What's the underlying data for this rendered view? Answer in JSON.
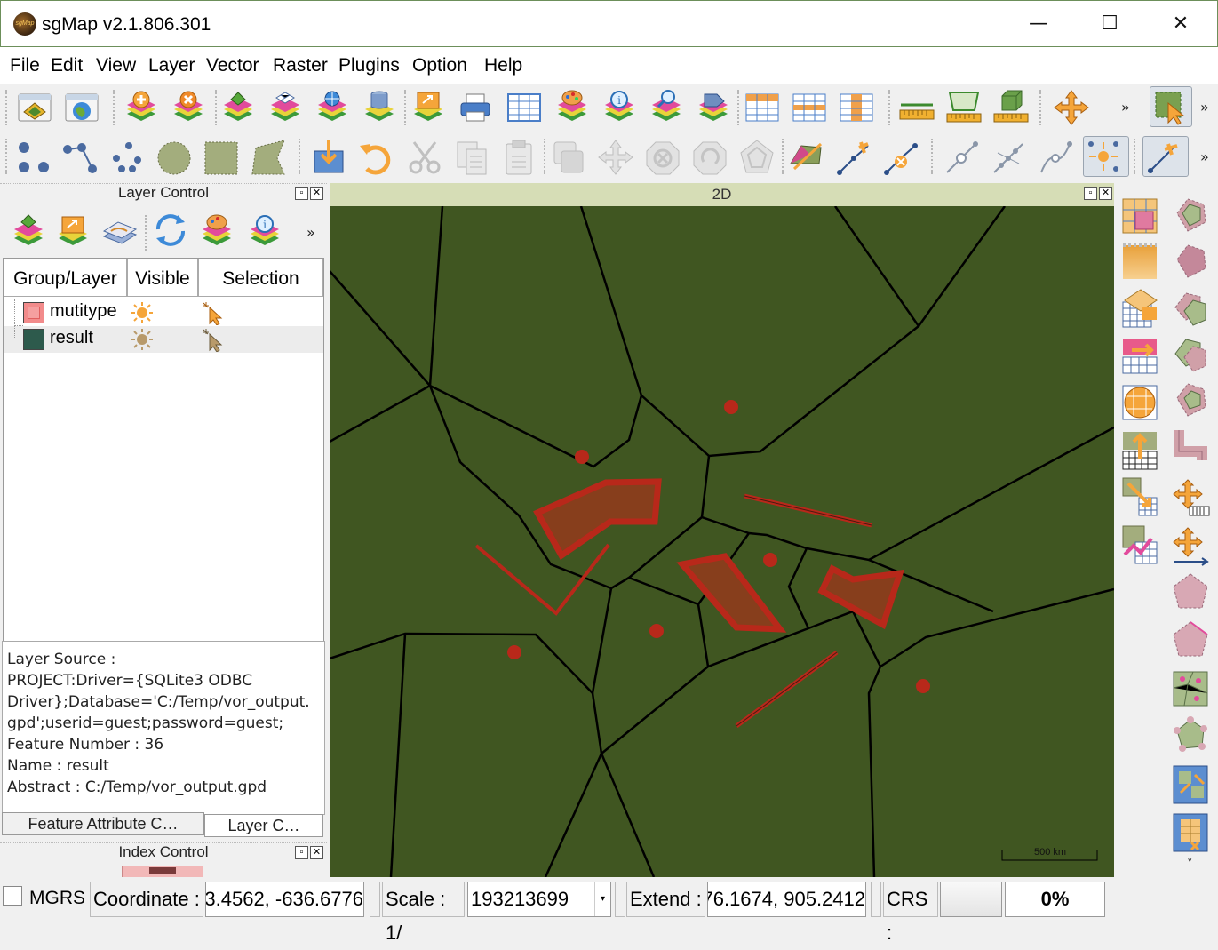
{
  "window": {
    "title": "sgMap v2.1.806.301",
    "logo_text": "sgMap",
    "minimize": "—",
    "maximize": "☐",
    "close": "✕"
  },
  "menu": [
    "File",
    "Edit",
    "View",
    "Layer",
    "Vector",
    "Raster",
    "Plugins",
    "Option",
    "Help"
  ],
  "toolbar": {
    "more": "»"
  },
  "layer_control": {
    "title": "Layer Control",
    "more": "»",
    "columns": [
      "Group/Layer",
      "Visible",
      "Selection"
    ],
    "layers": [
      {
        "name": "mutitype",
        "swatch": "#f28b8b"
      },
      {
        "name": "result",
        "swatch": "#2d5a4c"
      }
    ],
    "info": {
      "line1": "Layer Source :",
      "line2": "PROJECT:Driver={SQLite3 ODBC",
      "line3": "Driver};Database='C:/Temp/vor_output.",
      "line4": "gpd';userid=guest;password=guest;",
      "line5": "Feature Number : 36",
      "line6": "Name : result",
      "line7": "Abstract : C:/Temp/vor_output.gpd"
    },
    "tabs": [
      "Feature Attribute C…",
      "Layer C…"
    ]
  },
  "index_control": {
    "title": "Index Control"
  },
  "map": {
    "title": "2D",
    "scalebar_label": "500  km",
    "background": "#405621",
    "feature_color": "#b8281a"
  },
  "right_toolbar": {
    "more": "»"
  },
  "status": {
    "mgrs": "MGRS",
    "coordinate_label": "Coordinate :",
    "coordinate_value": "3.4562, -636.6776",
    "scale_label": "Scale : 1/",
    "scale_value": "193213699",
    "extend_label": "Extend :",
    "extend_value": "76.1674, 905.2412",
    "crs_label": "CRS :",
    "progress": "0%"
  }
}
